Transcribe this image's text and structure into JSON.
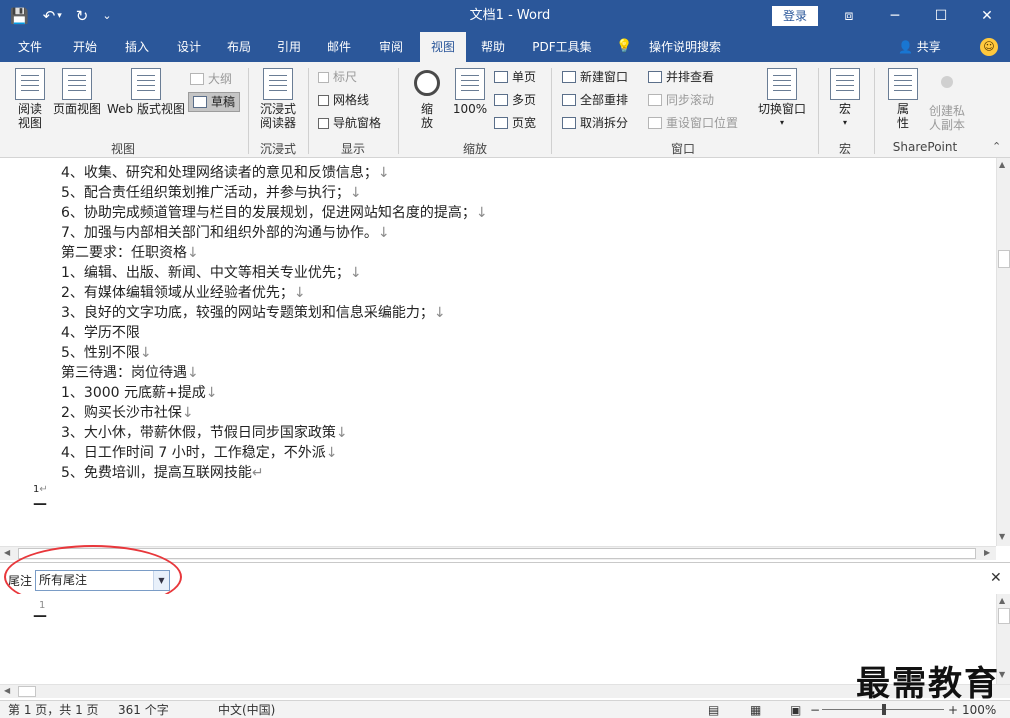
{
  "titlebar": {
    "qat": {
      "save_icon": "💾",
      "undo_icon": "↶",
      "undo_arrow": "▾",
      "redo_icon": "↻",
      "customize_icon": "⌄"
    },
    "title": "文档1 - Word",
    "login": "登录",
    "ribbon_display_icon": "⧈",
    "minimize_icon": "─",
    "maximize_icon": "☐",
    "close_icon": "✕"
  },
  "tabs": [
    {
      "label": "文件"
    },
    {
      "label": "开始"
    },
    {
      "label": "插入"
    },
    {
      "label": "设计"
    },
    {
      "label": "布局"
    },
    {
      "label": "引用"
    },
    {
      "label": "邮件"
    },
    {
      "label": "审阅"
    },
    {
      "label": "视图",
      "active": true
    },
    {
      "label": "帮助"
    },
    {
      "label": "PDF工具集"
    },
    {
      "label": "操作说明搜索"
    }
  ],
  "tell_me_icon": "💡",
  "share": {
    "icon": "👤",
    "label": "共享"
  },
  "smiley": "☺",
  "ribbon": {
    "views": {
      "group_label": "视图",
      "read_mode": "阅读\n视图",
      "read_mode_l1": "阅读",
      "read_mode_l2": "视图",
      "print_layout": "页面视图",
      "web_layout": "Web 版式视图",
      "outline": "大纲",
      "draft": "草稿"
    },
    "immersive": {
      "group_label": "沉浸式",
      "reader_l1": "沉浸式",
      "reader_l2": "阅读器"
    },
    "show": {
      "group_label": "显示",
      "ruler": "标尺",
      "gridlines": "网格线",
      "nav_pane": "导航窗格"
    },
    "zoom": {
      "group_label": "缩放",
      "zoom_l1": "缩",
      "zoom_l2": "放",
      "hundred": "100%",
      "one_page": "单页",
      "multi_page": "多页",
      "page_width": "页宽"
    },
    "window": {
      "group_label": "窗口",
      "new_window": "新建窗口",
      "arrange_all": "全部重排",
      "remove_split": "取消拆分",
      "side_by_side": "并排查看",
      "sync_scroll": "同步滚动",
      "reset_pos": "重设窗口位置",
      "switch_window": "切换窗口",
      "switch_arrow": "▾"
    },
    "macros": {
      "group_label": "宏",
      "macro": "宏",
      "macro_arrow": "▾"
    },
    "sharepoint": {
      "group_label": "SharePoint",
      "props_l1": "属",
      "props_l2": "性",
      "private_l1": "创建私",
      "private_l2": "人副本"
    },
    "collapse_icon": "⌃"
  },
  "document": {
    "lines": [
      "4、收集、研究和处理网络读者的意见和反馈信息；",
      "5、配合责任组织策划推广活动，并参与执行；",
      "6、协助完成频道管理与栏目的发展规划，促进网站知名度的提高；",
      "7、加强与内部相关部门和组织外部的沟通与协作。",
      "第二要求：任职资格",
      "1、编辑、出版、新闻、中文等相关专业优先；",
      "2、有媒体编辑领域从业经验者优先；",
      "3、良好的文字功底，较强的网站专题策划和信息采编能力；",
      "4、学历不限",
      "5、性别不限",
      "第三待遇：岗位待遇",
      "1、3000 元底薪+提成",
      "2、购买长沙市社保",
      "3、大小休，带薪休假，节假日同步国家政策",
      "4、日工作时间 7 小时，工作稳定，不外派",
      "5、免费培训，提高互联网技能"
    ],
    "line_marks": [
      "↓",
      "↓",
      "↓",
      "↓",
      "↓",
      "↓",
      "↓",
      "↓",
      "",
      "↓",
      "↓",
      "↓",
      "↓",
      "↓",
      "↓",
      "↵"
    ],
    "endnote_ref": "1",
    "para_mark": "↵",
    "separator": "—"
  },
  "endnote_pane": {
    "label": "尾注",
    "select_value": "所有尾注",
    "dropdown_icon": "▼",
    "close_icon": "✕",
    "endnote_ref": "1",
    "separator": "—"
  },
  "scroll": {
    "up": "▲",
    "down": "▼",
    "left": "◀",
    "right": "▶"
  },
  "status": {
    "page": "第 1 页，共 1 页",
    "words": "361 个字",
    "language": "中文(中国)",
    "zoom_minus": "−",
    "zoom_plus": "+",
    "zoom": "100%",
    "read_mode_icon": "▤",
    "print_icon": "▦",
    "web_icon": "▣"
  },
  "watermark": "最需教育"
}
